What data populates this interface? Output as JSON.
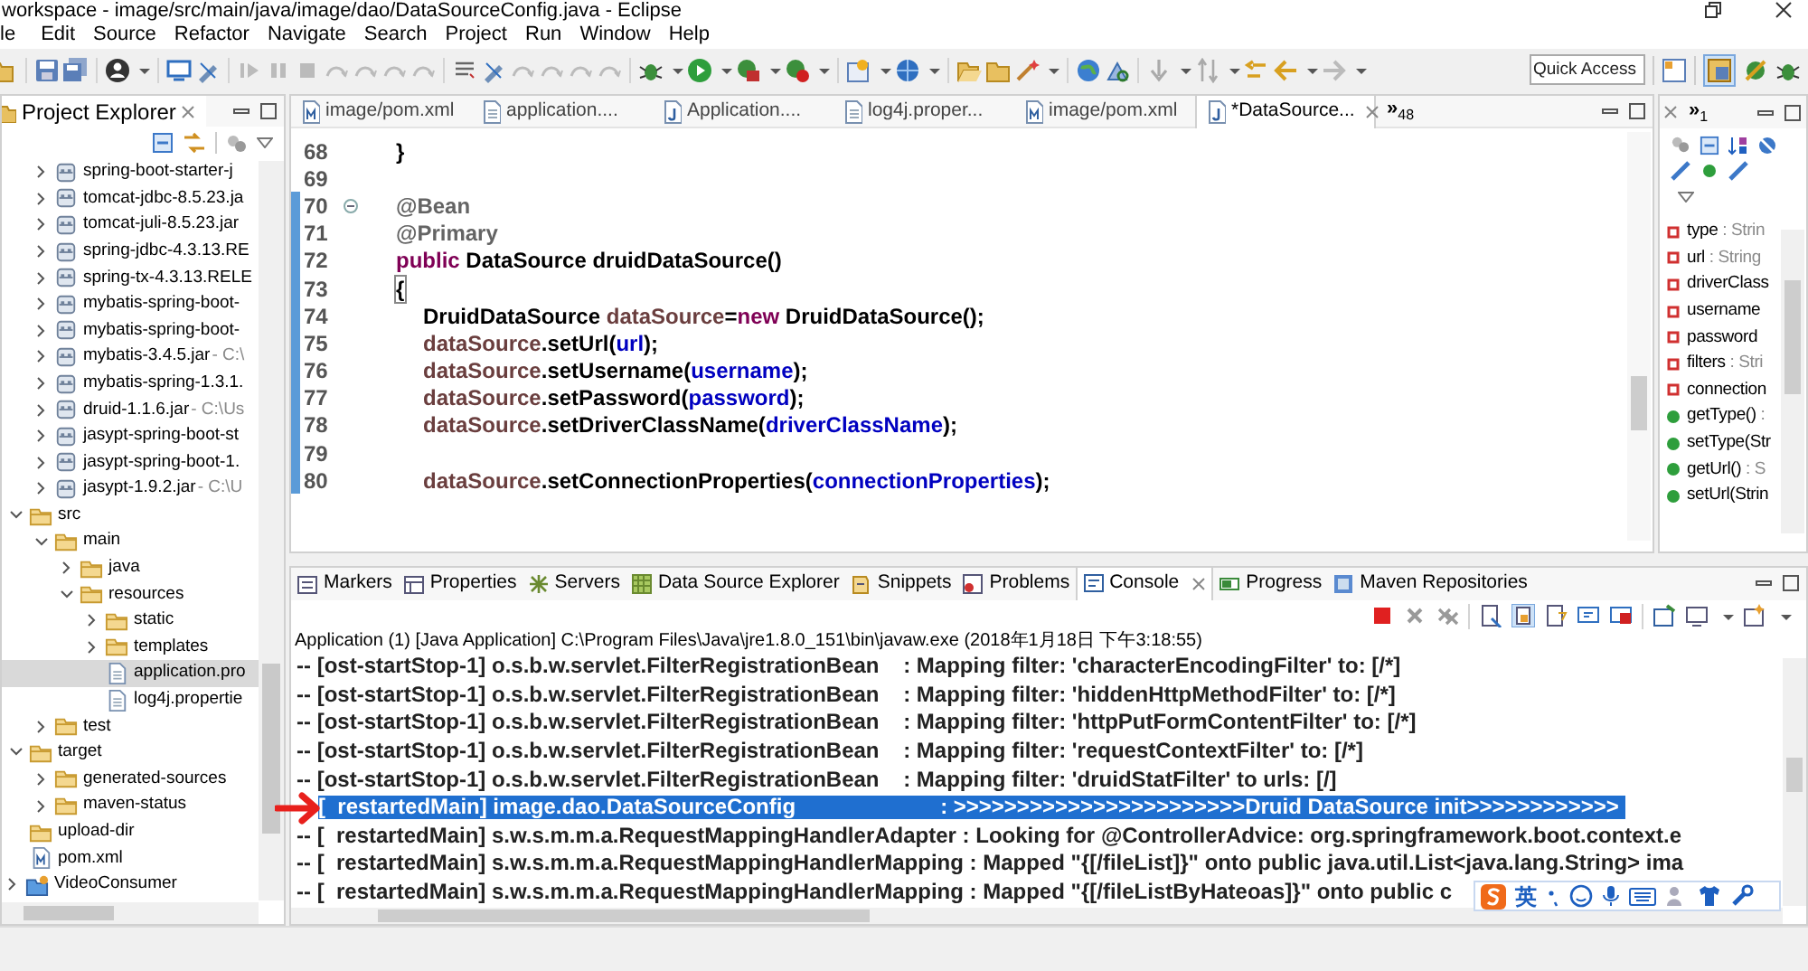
{
  "window": {
    "title": "workspace - image/src/main/java/image/dao/DataSourceConfig.java - Eclipse"
  },
  "menu": [
    "le",
    "Edit",
    "Source",
    "Refactor",
    "Navigate",
    "Search",
    "Project",
    "Run",
    "Window",
    "Help"
  ],
  "toolbar": {
    "quick_access": {
      "placeholder": "Quick Access"
    }
  },
  "project_explorer": {
    "title": "Project Explorer",
    "tree": {
      "scrolled_items": [
        {
          "label": "spring-boot-starter-j",
          "kind": "jar",
          "expanded": false,
          "selected": false
        },
        {
          "label": "tomcat-jdbc-8.5.23.ja",
          "kind": "jar",
          "expanded": false,
          "selected": false
        },
        {
          "label": "tomcat-juli-8.5.23.jar",
          "kind": "jar",
          "expanded": false,
          "selected": false
        },
        {
          "label": "spring-jdbc-4.3.13.RE",
          "kind": "jar",
          "expanded": false,
          "selected": false
        },
        {
          "label": "spring-tx-4.3.13.RELE",
          "kind": "jar",
          "expanded": false,
          "selected": false
        },
        {
          "label": "mybatis-spring-boot-",
          "kind": "jar",
          "expanded": false,
          "selected": false
        },
        {
          "label": "mybatis-spring-boot-",
          "kind": "jar",
          "expanded": false,
          "selected": false
        },
        {
          "label": "mybatis-3.4.5.jar",
          "decoration": " - C:\\",
          "kind": "jar",
          "expanded": false,
          "selected": false
        },
        {
          "label": "mybatis-spring-1.3.1.",
          "kind": "jar",
          "expanded": false,
          "selected": false
        },
        {
          "label": "druid-1.1.6.jar",
          "decoration": " - C:\\Us",
          "kind": "jar",
          "expanded": false,
          "selected": false
        },
        {
          "label": "jasypt-spring-boot-st",
          "kind": "jar",
          "expanded": false,
          "selected": false
        },
        {
          "label": "jasypt-spring-boot-1.",
          "kind": "jar",
          "expanded": false,
          "selected": false
        },
        {
          "label": "jasypt-1.9.2.jar",
          "decoration": " - C:\\U",
          "kind": "jar",
          "expanded": false,
          "selected": false
        }
      ],
      "items": [
        {
          "label": "src",
          "kind": "folder",
          "expanded": true,
          "selected": false,
          "children": [
            {
              "label": "main",
              "kind": "folder",
              "expanded": true,
              "selected": false,
              "children": [
                {
                  "label": "java",
                  "kind": "folder",
                  "expanded": false,
                  "selected": false
                },
                {
                  "label": "resources",
                  "kind": "folder",
                  "expanded": true,
                  "selected": false,
                  "children": [
                    {
                      "label": "static",
                      "kind": "folder",
                      "expanded": false,
                      "selected": false
                    },
                    {
                      "label": "templates",
                      "kind": "folder",
                      "expanded": false,
                      "selected": false
                    },
                    {
                      "label": "application.pro",
                      "kind": "file",
                      "selected": true
                    },
                    {
                      "label": "log4j.propertie",
                      "kind": "file",
                      "selected": false
                    }
                  ]
                }
              ]
            },
            {
              "label": "test",
              "kind": "folder",
              "expanded": false,
              "selected": false
            }
          ]
        },
        {
          "label": "target",
          "kind": "folder",
          "expanded": true,
          "selected": false,
          "children": [
            {
              "label": "generated-sources",
              "kind": "folder",
              "expanded": false,
              "selected": false
            },
            {
              "label": "maven-status",
              "kind": "folder",
              "expanded": false,
              "selected": false
            }
          ]
        },
        {
          "label": "upload-dir",
          "kind": "folder",
          "selected": false
        },
        {
          "label": "pom.xml",
          "kind": "xml",
          "selected": false
        }
      ],
      "projects": [
        {
          "label": "VideoConsumer",
          "kind": "project",
          "expanded": false,
          "selected": false
        }
      ]
    }
  },
  "editor": {
    "tabs": [
      {
        "label": "image/pom.xml",
        "kind": "xml",
        "selected": false
      },
      {
        "label": "application....",
        "kind": "file",
        "selected": false
      },
      {
        "label": "Application....",
        "kind": "java",
        "selected": false
      },
      {
        "label": "log4j.proper...",
        "kind": "file",
        "selected": false
      },
      {
        "label": "image/pom.xml",
        "kind": "xml",
        "selected": false
      },
      {
        "label": "*DataSource...",
        "kind": "java",
        "selected": true
      }
    ],
    "overflow": {
      "label": "»",
      "count": "48"
    },
    "lines": [
      {
        "number": "68",
        "changed": false,
        "tokens": [
          {
            "text": "}",
            "kind": "plain"
          }
        ]
      },
      {
        "number": "69",
        "changed": false
      },
      {
        "number": "70",
        "changed": true,
        "fold": true,
        "tokens": [
          {
            "text": "@Bean",
            "kind": "annotation"
          }
        ]
      },
      {
        "number": "71",
        "changed": true,
        "tokens": [
          {
            "text": "@Primary",
            "kind": "annotation"
          }
        ]
      },
      {
        "number": "72",
        "changed": true,
        "tokens": [
          {
            "text": "public",
            "kind": "keyword"
          },
          {
            "text": " DataSource druidDataSource()",
            "kind": "plain"
          }
        ]
      },
      {
        "number": "73",
        "changed": true,
        "tokens": [
          {
            "text": "{",
            "kind": "bracket"
          }
        ]
      },
      {
        "number": "74",
        "changed": true,
        "indented": true,
        "tokens": [
          {
            "text": "DruidDataSource ",
            "kind": "plain"
          },
          {
            "text": "dataSource",
            "kind": "local"
          },
          {
            "text": "=",
            "kind": "plain"
          },
          {
            "text": "new",
            "kind": "keyword"
          },
          {
            "text": " DruidDataSource();",
            "kind": "plain"
          }
        ]
      },
      {
        "number": "75",
        "changed": true,
        "indented": true,
        "tokens": [
          {
            "text": "dataSource",
            "kind": "local"
          },
          {
            "text": ".setUrl(",
            "kind": "plain"
          },
          {
            "text": "url",
            "kind": "field"
          },
          {
            "text": ");",
            "kind": "plain"
          }
        ]
      },
      {
        "number": "76",
        "changed": true,
        "indented": true,
        "tokens": [
          {
            "text": "dataSource",
            "kind": "local"
          },
          {
            "text": ".setUsername(",
            "kind": "plain"
          },
          {
            "text": "username",
            "kind": "field"
          },
          {
            "text": ");",
            "kind": "plain"
          }
        ]
      },
      {
        "number": "77",
        "changed": true,
        "indented": true,
        "tokens": [
          {
            "text": "dataSource",
            "kind": "local"
          },
          {
            "text": ".setPassword(",
            "kind": "plain"
          },
          {
            "text": "password",
            "kind": "field"
          },
          {
            "text": ");",
            "kind": "plain"
          }
        ]
      },
      {
        "number": "78",
        "changed": true,
        "indented": true,
        "tokens": [
          {
            "text": "dataSource",
            "kind": "local"
          },
          {
            "text": ".setDriverClassName(",
            "kind": "plain"
          },
          {
            "text": "driverClassName",
            "kind": "field"
          },
          {
            "text": ");",
            "kind": "plain"
          }
        ]
      },
      {
        "number": "79",
        "changed": true
      },
      {
        "number": "80",
        "changed": true,
        "indented": true,
        "tokens": [
          {
            "text": "dataSource",
            "kind": "local"
          },
          {
            "text": ".setConnectionProperties(",
            "kind": "plain"
          },
          {
            "text": "connectionProperties",
            "kind": "field"
          },
          {
            "text": ");",
            "kind": "plain"
          }
        ]
      }
    ]
  },
  "outline": {
    "overflow": {
      "label": "»",
      "count": "1"
    },
    "items": [
      {
        "kind": "field",
        "name": "type",
        "type": " : Strin"
      },
      {
        "kind": "field",
        "name": "url",
        "type": " : String"
      },
      {
        "kind": "field",
        "name": "driverClass"
      },
      {
        "kind": "field",
        "name": "username"
      },
      {
        "kind": "field",
        "name": "password"
      },
      {
        "kind": "field",
        "name": "filters",
        "type": " : Stri"
      },
      {
        "kind": "field",
        "name": "connection"
      },
      {
        "kind": "method",
        "name": "getType()",
        "type": " :"
      },
      {
        "kind": "method",
        "name": "setType(Str"
      },
      {
        "kind": "method",
        "name": "getUrl()",
        "type": " : S"
      },
      {
        "kind": "method",
        "name": "setUrl(Strin"
      }
    ]
  },
  "bottom_panel": {
    "tabs": [
      {
        "label": "Markers",
        "selected": false
      },
      {
        "label": "Properties",
        "selected": false
      },
      {
        "label": "Servers",
        "selected": false
      },
      {
        "label": "Data Source Explorer",
        "selected": false
      },
      {
        "label": "Snippets",
        "selected": false
      },
      {
        "label": "Problems",
        "selected": false
      },
      {
        "label": "Console",
        "selected": true
      },
      {
        "label": "Progress",
        "selected": false
      },
      {
        "label": "Maven Repositories",
        "selected": false
      }
    ],
    "console": {
      "header": "Application (1) [Java Application] C:\\Program Files\\Java\\jre1.8.0_151\\bin\\javaw.exe (2018年1月18日 下午3:18:55)",
      "lines": [
        {
          "text": "-- [ost-startStop-1] o.s.b.w.servlet.FilterRegistrationBean    : Mapping filter: 'characterEncodingFilter' to: [/*]",
          "selected": false
        },
        {
          "text": "-- [ost-startStop-1] o.s.b.w.servlet.FilterRegistrationBean    : Mapping filter: 'hiddenHttpMethodFilter' to: [/*]",
          "selected": false
        },
        {
          "text": "-- [ost-startStop-1] o.s.b.w.servlet.FilterRegistrationBean    : Mapping filter: 'httpPutFormContentFilter' to: [/*]",
          "selected": false
        },
        {
          "text": "-- [ost-startStop-1] o.s.b.w.servlet.FilterRegistrationBean    : Mapping filter: 'requestContextFilter' to: [/*]",
          "selected": false
        },
        {
          "text": "-- [ost-startStop-1] o.s.b.w.servlet.FilterRegistrationBean    : Mapping filter: 'druidStatFilter' to urls: [/]",
          "selected": false
        },
        {
          "text": "[  restartedMain] image.dao.DataSourceConfig                        : >>>>>>>>>>>>>>>>>>>>>>>Druid DataSource init>>>>>>>>>>>>",
          "selected": true
        },
        {
          "text": "-- [  restartedMain] s.w.s.m.m.a.RequestMappingHandlerAdapter : Looking for @ControllerAdvice: org.springframework.boot.context.e",
          "selected": false
        },
        {
          "text": "-- [  restartedMain] s.w.s.m.m.a.RequestMappingHandlerMapping : Mapped \"{[/fileList]}\" onto public java.util.List<java.lang.String> ima",
          "selected": false
        },
        {
          "text": "-- [  restartedMain] s.w.s.m.m.a.RequestMappingHandlerMapping : Mapped \"{[/fileListByHateoas]}\" onto public c",
          "selected": false
        }
      ]
    }
  },
  "ime_toolbar": {
    "mode": "英"
  }
}
